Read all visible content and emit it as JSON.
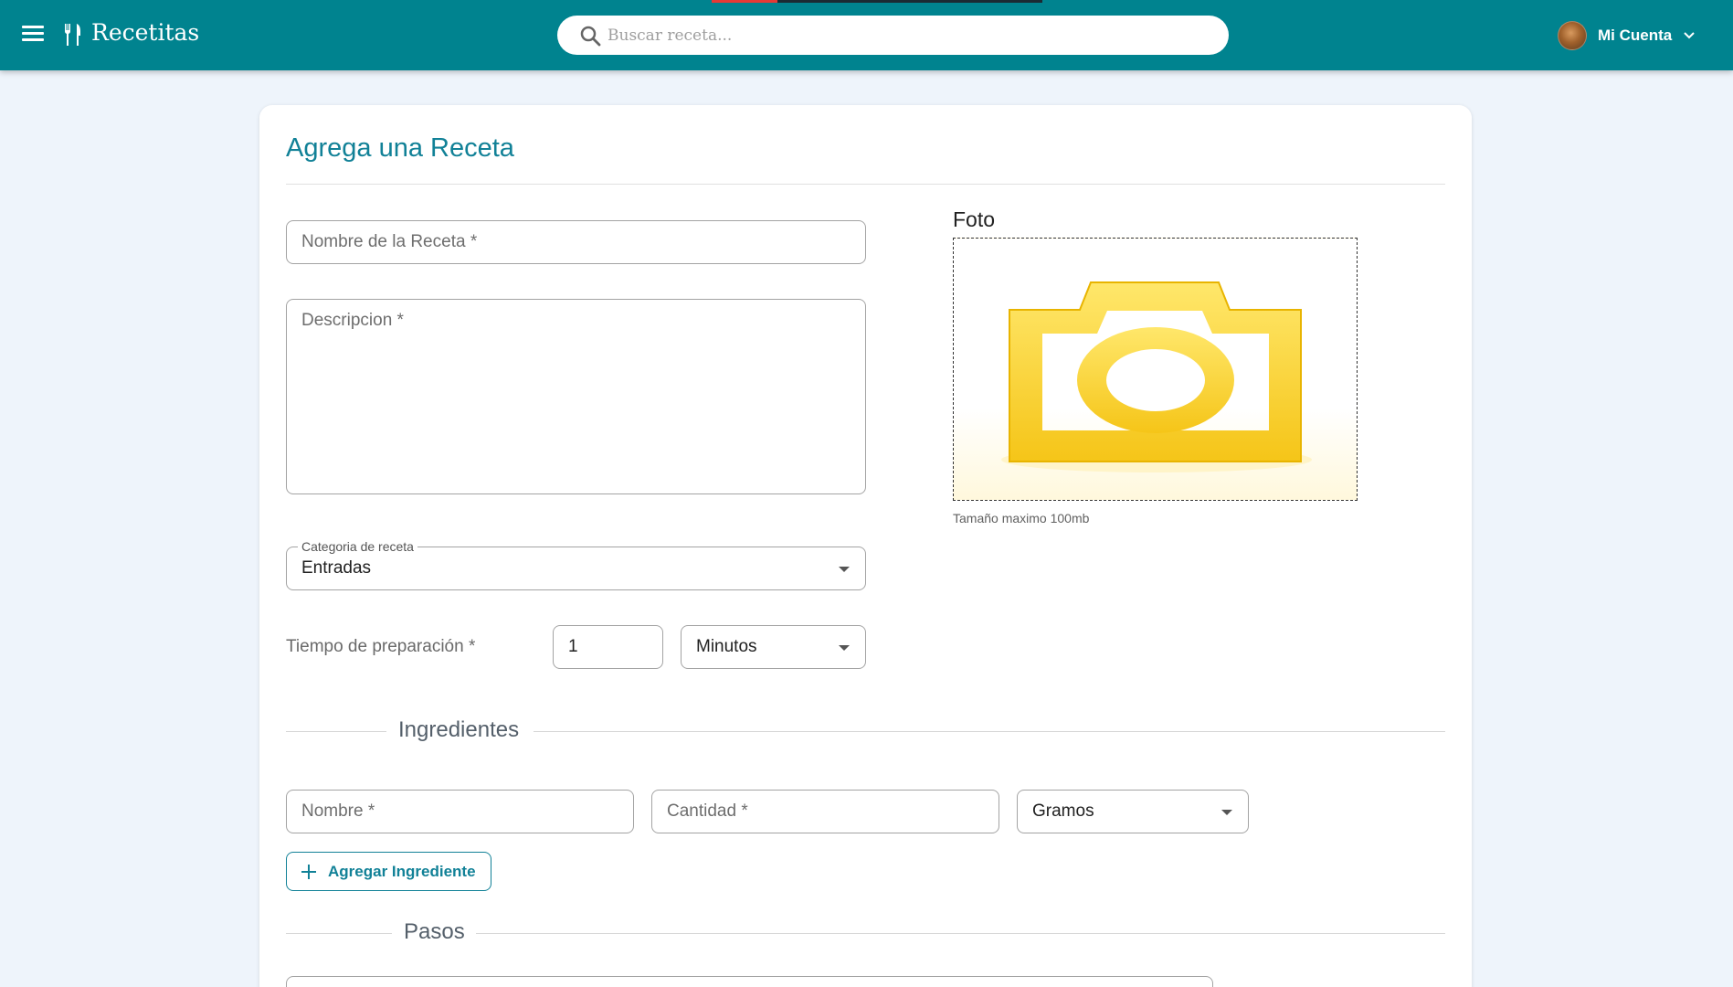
{
  "app": {
    "title": "Recetitas",
    "search_placeholder": "Buscar receta...",
    "account_label": "Mi Cuenta",
    "primary_color": "#00838f",
    "accent_color": "#118197"
  },
  "form": {
    "title": "Agrega una Receta",
    "name_placeholder": "Nombre de la Receta *",
    "description_placeholder": "Descripcion *",
    "category_label": "Categoria de receta",
    "category_value": "Entradas",
    "prep_label": "Tiempo de preparación *",
    "prep_value": "1",
    "prep_unit": "Minutos",
    "photo_label": "Foto",
    "photo_hint": "Tamaño maximo 100mb"
  },
  "ingredients": {
    "section_title": "Ingredientes",
    "name_placeholder": "Nombre *",
    "quantity_placeholder": "Cantidad *",
    "unit_value": "Gramos",
    "add_button": "Agregar Ingrediente"
  },
  "steps": {
    "section_title": "Pasos"
  },
  "icons": [
    "menu-icon",
    "fork-knife-icon",
    "search-icon",
    "chevron-down-icon",
    "plus-icon",
    "camera-icon",
    "dropdown-caret-icon"
  ]
}
